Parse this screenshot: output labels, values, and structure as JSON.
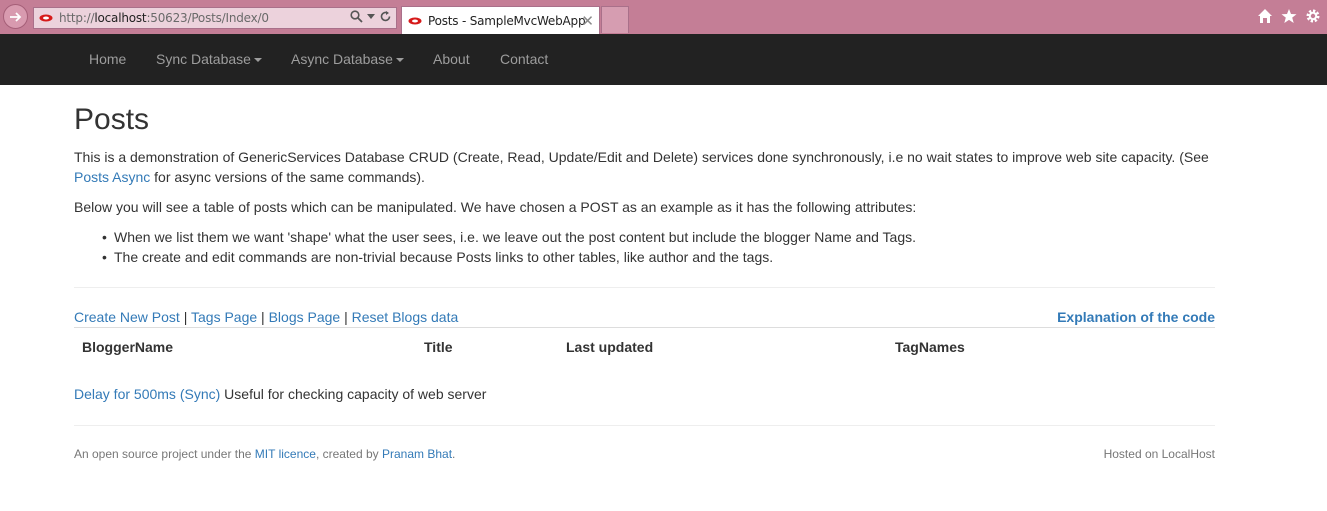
{
  "browser": {
    "url_prefix": "http://",
    "url_host": "localhost",
    "url_rest": ":50623/Posts/Index/0",
    "tab_title": "Posts - SampleMvcWebApp",
    "tab_close": "✕"
  },
  "navbar": {
    "items": [
      {
        "label": "Home"
      },
      {
        "label": "Sync Database"
      },
      {
        "label": "Async Database"
      },
      {
        "label": "About"
      },
      {
        "label": "Contact"
      }
    ]
  },
  "page": {
    "title": "Posts",
    "intro_text": "This is a demonstration of GenericServices Database CRUD (Create, Read, Update/Edit and Delete) services done synchronously, i.e no wait states to improve web site capacity. (See",
    "intro_link": "Posts Async",
    "intro_after": " for async versions of the same commands).",
    "below_text": "Below you will see a table of posts which can be manipulated. We have chosen a POST as an example as it has the following attributes:",
    "bullets": [
      "When we list them we want 'shape' what the user sees, i.e. we leave out the post content but include the blogger Name and Tags.",
      "The create and edit commands are non-trivial because Posts links to other tables, like author and the tags."
    ]
  },
  "actions": {
    "create": "Create New Post",
    "tags": "Tags Page",
    "blogs": "Blogs Page",
    "reset": "Reset Blogs data",
    "sep": " | ",
    "explanation": "Explanation of the code"
  },
  "table": {
    "headers": [
      "BloggerName",
      "Title",
      "Last updated",
      "TagNames"
    ]
  },
  "delay": {
    "link": "Delay for 500ms (Sync)",
    "text": " Useful for checking capacity of web server"
  },
  "footer": {
    "prefix": "An open source project under the ",
    "licence_link": "MIT licence",
    "middle": ", created by ",
    "author_link": "Pranam Bhat",
    "suffix": ".",
    "hosted": "Hosted on LocalHost"
  },
  "colors": {
    "chrome": "#c47e96",
    "navbar": "#222222",
    "link": "#337ab7"
  }
}
